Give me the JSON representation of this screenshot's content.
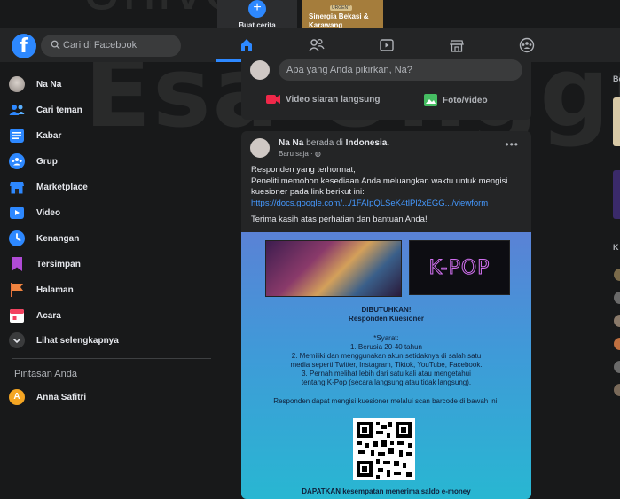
{
  "stories": {
    "create_label": "Buat cerita",
    "story2_badge": "URGENT",
    "story2_label": "Sinergia Bekasi & Karawang"
  },
  "header": {
    "search_placeholder": "Cari di Facebook"
  },
  "sidebar": {
    "items": [
      {
        "label": "Na Na",
        "icon": "avatar"
      },
      {
        "label": "Cari teman",
        "icon": "friends-icon"
      },
      {
        "label": "Kabar",
        "icon": "news-icon"
      },
      {
        "label": "Grup",
        "icon": "groups-icon"
      },
      {
        "label": "Marketplace",
        "icon": "marketplace-icon"
      },
      {
        "label": "Video",
        "icon": "video-icon"
      },
      {
        "label": "Kenangan",
        "icon": "memories-icon"
      },
      {
        "label": "Tersimpan",
        "icon": "saved-icon"
      },
      {
        "label": "Halaman",
        "icon": "pages-icon"
      },
      {
        "label": "Acara",
        "icon": "events-icon"
      },
      {
        "label": "Lihat selengkapnya",
        "icon": "chevron-down-icon"
      }
    ],
    "shortcuts_title": "Pintasan Anda",
    "shortcut_user": "Anna Safitri",
    "shortcut_initial": "A"
  },
  "composer": {
    "placeholder": "Apa yang Anda pikirkan, Na?",
    "live_label": "Video siaran langsung",
    "photo_label": "Foto/video"
  },
  "post": {
    "author": "Na Na",
    "connector": "berada di",
    "location": "Indonesia",
    "time": "Baru saja",
    "line1": "Responden yang terhormat,",
    "line2": "Peneliti memohon kesediaan Anda meluangkan waktu untuk mengisi kuesioner pada link berikut ini:",
    "link": "https://docs.google.com/.../1FAIpQLSeK4tlPl2xEGG.../viewform",
    "line3": "Terima kasih atas perhatian dan bantuan Anda!",
    "flyer": {
      "kpop": "K-POP",
      "needed": "DIBUTUHKAN!",
      "respondents": "Responden Kuesioner",
      "syarat": "*Syarat:",
      "req1": "1. Berusia 20-40 tahun",
      "req2a": "2. Memiliki dan menggunakan akun setidaknya di salah satu",
      "req2b": "media seperti Twitter, Instagram, Tiktok, YouTube, Facebook.",
      "req3a": "3. Pernah melihat lebih dari satu kali atau mengetahui",
      "req3b": "tentang K-Pop (secara langsung atau tidak langsung).",
      "scan": "Responden dapat mengisi kuesioner melalui scan barcode di bawah ini!",
      "bottom": "DAPATKAN kesempatan menerima saldo e-money"
    }
  },
  "right": {
    "b_label": "Be",
    "k_label": "K"
  },
  "watermark": {
    "top": "Univer",
    "main": "Esa Unggul"
  },
  "colors": {
    "accent": "#2d88ff",
    "background": "#18191a",
    "surface": "#242526",
    "link": "#4599ff"
  }
}
